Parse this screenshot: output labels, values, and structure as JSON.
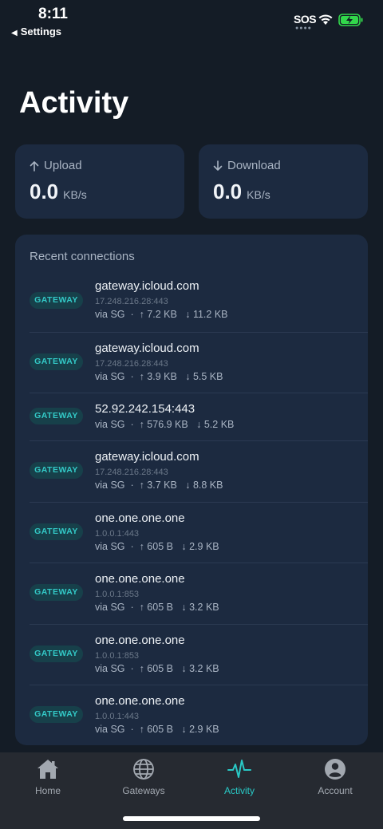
{
  "status": {
    "time": "8:11",
    "back_label": "Settings",
    "carrier": "SOS"
  },
  "page_title": "Activity",
  "stats": {
    "upload": {
      "label": "Upload",
      "value": "0.0",
      "unit": "KB/s"
    },
    "download": {
      "label": "Download",
      "value": "0.0",
      "unit": "KB/s"
    }
  },
  "recent": {
    "title": "Recent connections",
    "items": [
      {
        "badge": "GATEWAY",
        "host": "gateway.icloud.com",
        "ip": "17.248.216.28:443",
        "meta": "via SG  ·  ↑ 7.2 KB   ↓ 11.2 KB"
      },
      {
        "badge": "GATEWAY",
        "host": "gateway.icloud.com",
        "ip": "17.248.216.28:443",
        "meta": "via SG  ·  ↑ 3.9 KB   ↓ 5.5 KB"
      },
      {
        "badge": "GATEWAY",
        "host": "52.92.242.154:443",
        "ip": "",
        "meta": "via SG  ·  ↑ 576.9 KB   ↓ 5.2 KB"
      },
      {
        "badge": "GATEWAY",
        "host": "gateway.icloud.com",
        "ip": "17.248.216.28:443",
        "meta": "via SG  ·  ↑ 3.7 KB   ↓ 8.8 KB"
      },
      {
        "badge": "GATEWAY",
        "host": "one.one.one.one",
        "ip": "1.0.0.1:443",
        "meta": "via SG  ·  ↑ 605 B   ↓ 2.9 KB"
      },
      {
        "badge": "GATEWAY",
        "host": "one.one.one.one",
        "ip": "1.0.0.1:853",
        "meta": "via SG  ·  ↑ 605 B   ↓ 3.2 KB"
      },
      {
        "badge": "GATEWAY",
        "host": "one.one.one.one",
        "ip": "1.0.0.1:853",
        "meta": "via SG  ·  ↑ 605 B   ↓ 3.2 KB"
      },
      {
        "badge": "GATEWAY",
        "host": "one.one.one.one",
        "ip": "1.0.0.1:443",
        "meta": "via SG  ·  ↑ 605 B   ↓ 2.9 KB"
      }
    ]
  },
  "tabs": [
    {
      "label": "Home",
      "icon": "home-icon",
      "active": false
    },
    {
      "label": "Gateways",
      "icon": "globe-icon",
      "active": false
    },
    {
      "label": "Activity",
      "icon": "pulse-icon",
      "active": true
    },
    {
      "label": "Account",
      "icon": "account-icon",
      "active": false
    }
  ],
  "colors": {
    "background": "#141c26",
    "card": "#1c2a40",
    "accent": "#29c9c6",
    "badge_bg": "#17404a"
  }
}
